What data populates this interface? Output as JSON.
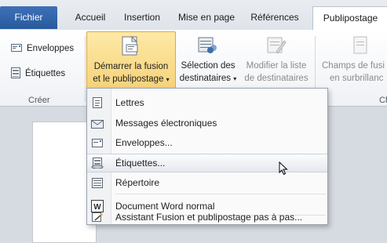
{
  "tabs": {
    "file": "Fichier",
    "items": [
      "Accueil",
      "Insertion",
      "Mise en page",
      "Références",
      "Publipostage"
    ]
  },
  "ribbon": {
    "create_group": {
      "envelopes": "Enveloppes",
      "labels": "Étiquettes",
      "label": "Créer"
    },
    "start_merge": {
      "line1": "Démarrer la fusion",
      "line2": "et le publipostage"
    },
    "select_recipients": {
      "line1": "Sélection des",
      "line2": "destinataires"
    },
    "edit_list": {
      "line1": "Modifier la liste",
      "line2": "de destinataires"
    },
    "highlight_fields": {
      "line1": "Champs de fusi",
      "line2": "en surbrillanc"
    },
    "right_group_label": "Ch"
  },
  "menu": {
    "items": [
      "Lettres",
      "Messages électroniques",
      "Enveloppes...",
      "Étiquettes...",
      "Répertoire",
      "Document Word normal",
      "Assistant Fusion et publipostage pas à pas..."
    ],
    "highlighted_index": 3
  },
  "colors": {
    "file_tab": "#2f63a8",
    "highlight": "#f6d27a"
  }
}
